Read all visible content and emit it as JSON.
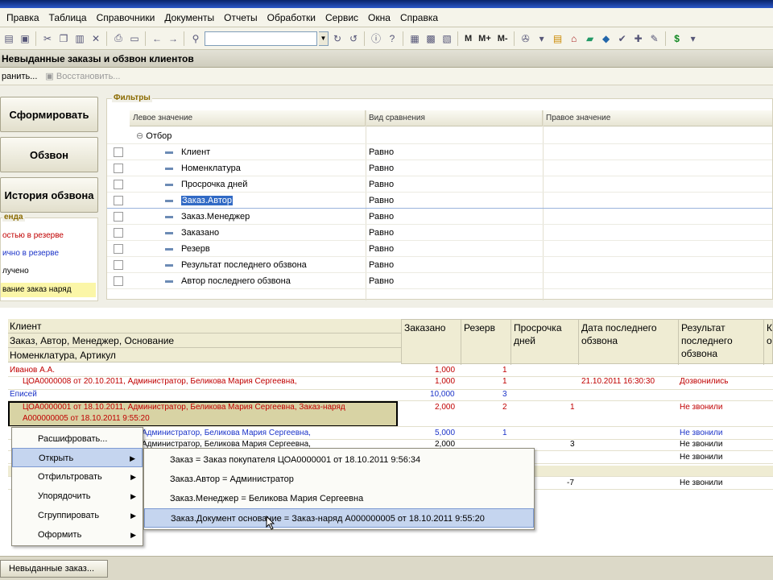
{
  "menu": [
    "Правка",
    "Таблица",
    "Справочники",
    "Документы",
    "Отчеты",
    "Обработки",
    "Сервис",
    "Окна",
    "Справка"
  ],
  "toolbar_text": [
    "M",
    "M+",
    "M-"
  ],
  "doc": {
    "title": "Невыданные заказы и обзвон клиентов",
    "save": "ранить...",
    "restore": "Восстановить..."
  },
  "left_buttons": [
    "Сформировать",
    "Обзвон",
    "История обзвона"
  ],
  "legend": {
    "title": "енда",
    "items": [
      {
        "label": "остью в резерве",
        "color": "#c00000",
        "bg": ""
      },
      {
        "label": "ично в резерве",
        "color": "#1b33c8",
        "bg": ""
      },
      {
        "label": "лучено",
        "color": "#000000",
        "bg": ""
      },
      {
        "label": "вание заказ наряд",
        "color": "#000000",
        "bg": "#fbf6a8"
      }
    ]
  },
  "filters": {
    "title": "Фильтры",
    "columns": [
      "Левое значение",
      "Вид сравнения",
      "Правое значение"
    ],
    "group": "Отбор",
    "rows": [
      {
        "left": "Клиент",
        "cmp": "Равно"
      },
      {
        "left": "Номенклатура",
        "cmp": "Равно"
      },
      {
        "left": "Просрочка дней",
        "cmp": "Равно"
      },
      {
        "left": "Заказ.Автор",
        "cmp": "Равно"
      },
      {
        "left": "Заказ.Менеджер",
        "cmp": "Равно"
      },
      {
        "left": "Заказано",
        "cmp": "Равно"
      },
      {
        "left": "Резерв",
        "cmp": "Равно"
      },
      {
        "left": "Результат последнего обзвона",
        "cmp": "Равно"
      },
      {
        "left": "Автор последнего обзвона",
        "cmp": "Равно"
      }
    ]
  },
  "report": {
    "left_headers": [
      "Клиент",
      "Заказ, Автор, Менеджер, Основание",
      "Номенклатура, Артикул"
    ],
    "headers": [
      "Заказано",
      "Резерв",
      "Просрочка дней",
      "Дата последнего обзвона",
      "Результат последнего обзвона",
      "К о"
    ],
    "rows": [
      {
        "name": "Иванов А.А.",
        "zak": "1,000",
        "rez": "1",
        "pros": "",
        "date": "",
        "res": "",
        "color": "red",
        "indent": 0
      },
      {
        "name": "ЦОА0000008 от 20.10.2011, Администратор, Беликова Мария Сергеевна,",
        "zak": "1,000",
        "rez": "1",
        "pros": "",
        "date": "21.10.2011 16:30:30",
        "res": "Дозвонились",
        "color": "red",
        "indent": 16
      },
      {
        "name": "Еписей",
        "zak": "10,000",
        "rez": "3",
        "pros": "",
        "date": "",
        "res": "",
        "color": "blue",
        "indent": 0
      },
      {
        "name": "ЦОА0000001 от 18.10.2011, Администратор, Беликова Мария Сергеевна, Заказ-наряд",
        "zak": "2,000",
        "rez": "2",
        "pros": "1",
        "date": "",
        "res": "Не звонили",
        "color": "red",
        "indent": 16
      },
      {
        "name": "А000000005 от 18.10.2011 9:55:20",
        "zak": "",
        "rez": "",
        "pros": "",
        "date": "",
        "res": "",
        "color": "red",
        "indent": 16
      },
      {
        "name": "Администратор, Беликова Мария Сергеевна,",
        "zak": "5,000",
        "rez": "1",
        "pros": "",
        "date": "",
        "res": "Не звонили",
        "color": "blue",
        "indent": 166
      },
      {
        "name": "Администратор, Беликова Мария Сергеевна,",
        "zak": "2,000",
        "rez": "",
        "pros": "3",
        "date": "",
        "res": "Не звонили",
        "color": "black",
        "indent": 166
      },
      {
        "name": "",
        "zak": "",
        "rez": "",
        "pros": "",
        "date": "",
        "res": "Не звонили",
        "color": "black",
        "indent": 0
      },
      {
        "name": "",
        "zak": "",
        "rez": "",
        "pros": "-7",
        "date": "",
        "res": "Не звонили",
        "color": "black",
        "indent": 0
      }
    ]
  },
  "context_menu": {
    "items": [
      {
        "label": "Расшифровать...",
        "sub": false,
        "hl": false
      },
      {
        "label": "Открыть",
        "sub": true,
        "hl": true
      },
      {
        "label": "Отфильтровать",
        "sub": true,
        "hl": false
      },
      {
        "label": "Упорядочить",
        "sub": true,
        "hl": false
      },
      {
        "label": "Сгруппировать",
        "sub": true,
        "hl": false
      },
      {
        "label": "Оформить",
        "sub": true,
        "hl": false
      }
    ],
    "submenu": [
      {
        "label": "Заказ = Заказ покупателя ЦОА0000001 от 18.10.2011 9:56:34",
        "hl": false
      },
      {
        "label": "Заказ.Автор = Администратор",
        "hl": false
      },
      {
        "label": "Заказ.Менеджер = Беликова Мария Сергеевна",
        "hl": false
      },
      {
        "label": "Заказ.Документ основание = Заказ-наряд А000000005 от 18.10.2011 9:55:20",
        "hl": true
      }
    ]
  },
  "taskbar": {
    "item": "Невыданные заказ..."
  }
}
